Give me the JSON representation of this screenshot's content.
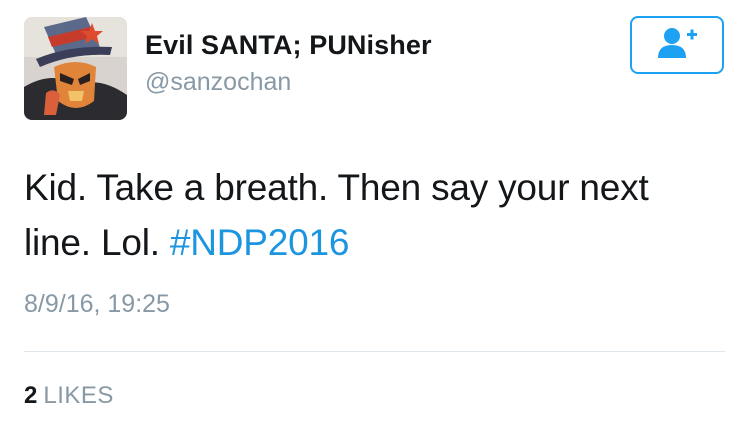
{
  "user": {
    "display_name": "Evil SANTA; PUNisher",
    "handle": "@sanzochan",
    "avatar_icon": "profile-photo"
  },
  "follow_button": {
    "icon": "add-user-icon",
    "color": "#1da1f2"
  },
  "tweet": {
    "text": "Kid. Take a breath. Then say your next line. Lol. ",
    "hashtag": "#NDP2016",
    "timestamp": "8/9/16, 19:25"
  },
  "stats": {
    "likes_count": "2",
    "likes_label": "LIKES"
  },
  "colors": {
    "text": "#14171a",
    "secondary": "#8899a6",
    "link": "#1b95e0",
    "divider": "#e1e8ed"
  }
}
